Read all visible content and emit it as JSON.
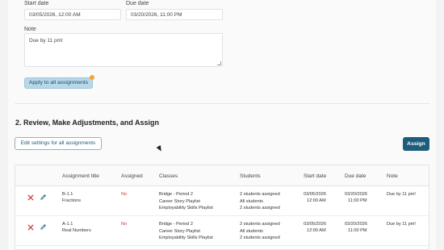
{
  "form": {
    "start_date_label": "Start date",
    "start_date_value": "03/05/2026, 12:00 AM",
    "due_date_label": "Due date",
    "due_date_value": "03/20/2026, 11:00 PM",
    "note_label": "Note",
    "note_value": "Due by 11 pm!",
    "apply_button": "Apply to all assignments"
  },
  "section": {
    "title": "2. Review, Make Adjustments, and Assign",
    "edit_button": "Edit settings for all assignments",
    "assign_button": "Assign"
  },
  "table": {
    "headers": {
      "title": "Assignment title",
      "assigned": "Assigned",
      "classes": "Classes",
      "students": "Students",
      "start": "Start date",
      "due": "Due date",
      "note": "Note"
    },
    "rows": [
      {
        "code": "B-1.1",
        "name": "Fractions",
        "assigned": "No",
        "class1": "Bridge - Period 2",
        "class2": "Career Story Playlist",
        "class3": "Employability Skills Playlist",
        "stud1": "2 students assigned",
        "stud2": "All students",
        "stud3": "2 students assigned",
        "start_date": "03/05/2026",
        "start_time": "12:00 AM",
        "due_date": "03/20/2026",
        "due_time": "11:00 PM",
        "note": "Due by 11 pm!"
      },
      {
        "code": "A-1.1",
        "name": "Real Numbers",
        "assigned": "No",
        "class1": "Bridge - Period 2",
        "class2": "Career Story Playlist",
        "class3": "Employability Skills Playlist",
        "stud1": "2 students assigned",
        "stud2": "All students",
        "stud3": "2 students assigned",
        "start_date": "03/05/2026",
        "start_time": "12:00 AM",
        "due_date": "03/20/2026",
        "due_time": "11:00 PM",
        "note": "Due by 11 pm!"
      }
    ]
  },
  "icons": {
    "remove": "close-icon",
    "edit": "pencil-icon"
  },
  "colors": {
    "primary": "#1d5d7b",
    "apply_bg": "#b7d8e9",
    "notification_dot": "#f0a637",
    "assigned_no": "#c93636"
  }
}
